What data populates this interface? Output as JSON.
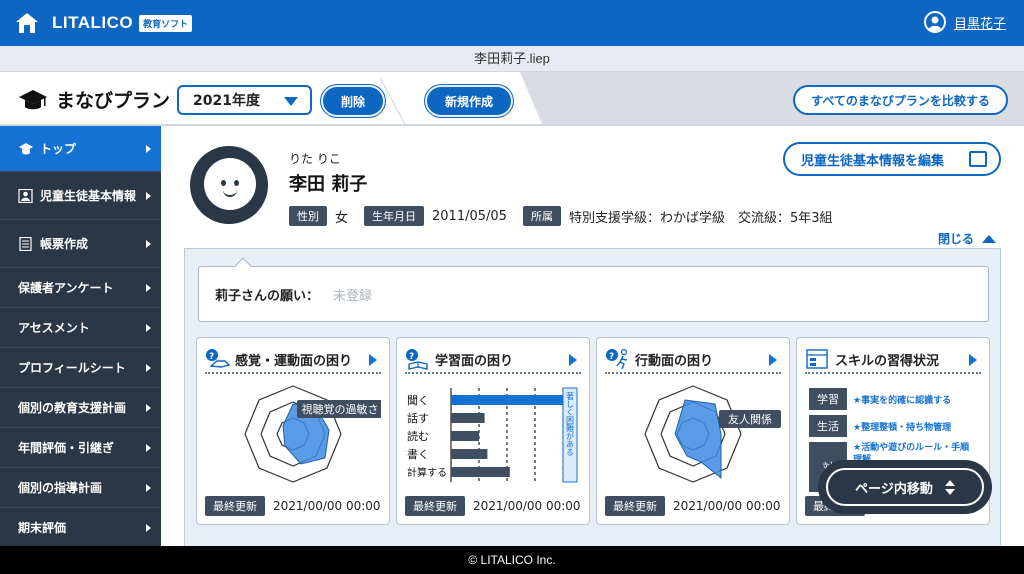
{
  "header": {
    "logo": "LITALICO",
    "logo_badge": "教育ソフト",
    "user_name": "目黒花子"
  },
  "file": {
    "name": "李田莉子.liep"
  },
  "planbar": {
    "title": "まなびプラン",
    "year": "2021年度",
    "delete_label": "削除",
    "new_label": "新規作成",
    "compare_label": "すべてのまなびプランを比較する"
  },
  "sidebar": {
    "items": [
      {
        "label": "トップ",
        "active": true
      },
      {
        "label": "児童生徒基本情報"
      },
      {
        "label": "帳票作成"
      },
      {
        "label": "保護者アンケート"
      },
      {
        "label": "アセスメント"
      },
      {
        "label": "プロフィールシート"
      },
      {
        "label": "個別の教育支援計画"
      },
      {
        "label": "年間評価・引継ぎ"
      },
      {
        "label": "個別の指導計画"
      },
      {
        "label": "期末評価"
      }
    ]
  },
  "student": {
    "furigana": "りた りこ",
    "name": "李田 莉子",
    "gender_label": "性別",
    "gender": "女",
    "birth_label": "生年月日",
    "birth": "2011/05/05",
    "affiliation_label": "所属",
    "affiliation": "特別支援学級：わかば学級　交流級：5年3組"
  },
  "edit_label": "児童生徒基本情報を編集",
  "close_label": "閉じる",
  "wish": {
    "label": "莉子さんの願い：",
    "value": "未登録"
  },
  "cards": [
    {
      "title": "感覚・運動面の困り",
      "callout": "視聴覚の過敏さ",
      "updated_label": "最終更新",
      "updated": "2021/00/00 00:00"
    },
    {
      "title": "学習面の困り",
      "updated_label": "最終更新",
      "updated": "2021/00/00 00:00"
    },
    {
      "title": "行動面の困り",
      "callout": "友人関係",
      "updated_label": "最終更新",
      "updated": "2021/00/00 00:00"
    },
    {
      "title": "スキルの習得状況",
      "updated_label": "最終更新"
    }
  ],
  "learning_bars": {
    "categories": [
      "聞く",
      "話す",
      "読む",
      "書く",
      "計算する"
    ],
    "values": [
      4,
      1.2,
      1,
      1.3,
      2.1
    ],
    "max": 4,
    "threshold_label": "著しく困難がある"
  },
  "skills": [
    {
      "tag": "学習",
      "text": "★事実を的確に認識する"
    },
    {
      "tag": "生活",
      "text": "★整理整頓・持ち物管理"
    },
    {
      "tag": "対",
      "text": "★活動や遊びのルール・手順理解"
    }
  ],
  "page_nav_label": "ページ内移動",
  "footer": "© LITALICO Inc."
}
